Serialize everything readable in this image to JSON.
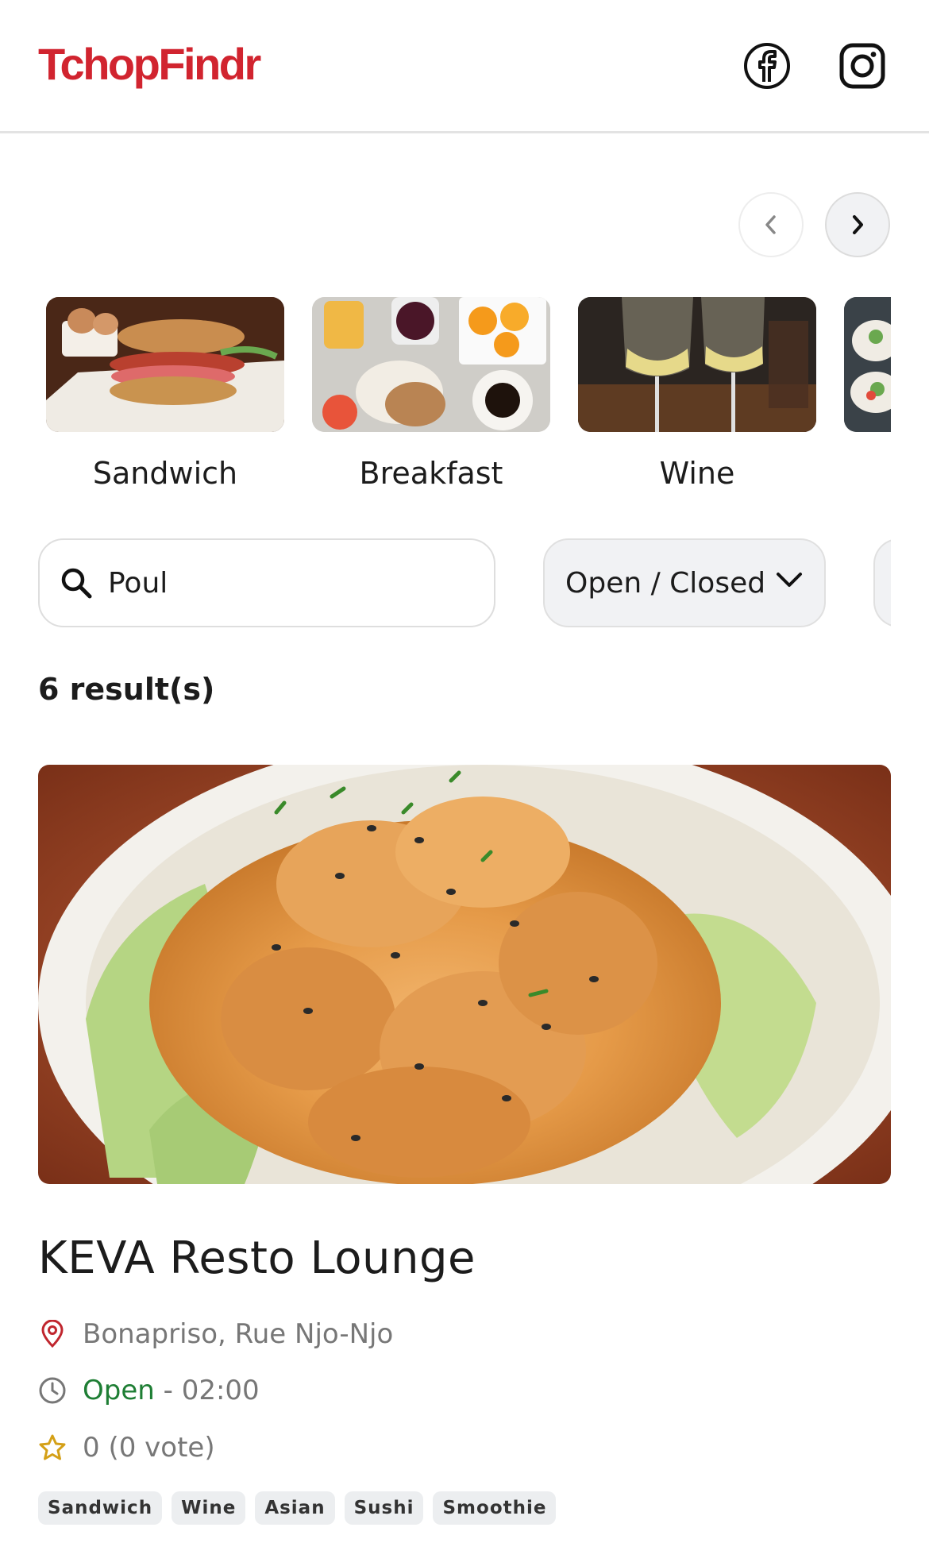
{
  "app": {
    "logo": "TchopFindr"
  },
  "header": {
    "social": [
      {
        "name": "facebook-icon"
      },
      {
        "name": "instagram-icon"
      }
    ]
  },
  "carousel": {
    "categories": [
      {
        "label": "Sandwich"
      },
      {
        "label": "Breakfast"
      },
      {
        "label": "Wine"
      },
      {
        "label": ""
      }
    ]
  },
  "filters": {
    "search": {
      "value": "Poul",
      "placeholder": ""
    },
    "status_select": {
      "label": "Open / Closed"
    }
  },
  "results": {
    "count_label": "6 result(s)"
  },
  "restaurant": {
    "name": "KEVA Resto Lounge",
    "address": "Bonapriso, Rue Njo-Njo",
    "status": "Open",
    "hours": " - 02:00",
    "rating": "0 (0 vote)",
    "tags": [
      "Sandwich",
      "Wine",
      "Asian",
      "Sushi",
      "Smoothie"
    ]
  },
  "colors": {
    "brand": "#d1242f",
    "open": "#1e7e34",
    "star": "#d4a017",
    "pin": "#c0262e"
  }
}
